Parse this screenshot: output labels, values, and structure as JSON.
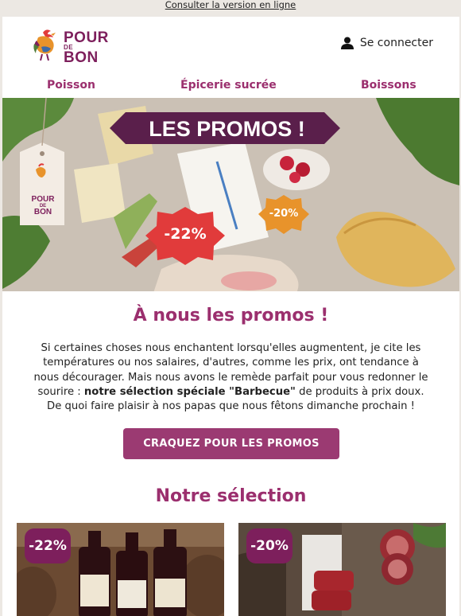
{
  "top_link": "Consulter la version en ligne",
  "brand": {
    "logo_line1": "POUR",
    "logo_de": "DE",
    "logo_line2": "BON"
  },
  "header": {
    "login_label": "Se connecter",
    "login_icon": "user-icon"
  },
  "nav": {
    "items": [
      {
        "label": "Poisson"
      },
      {
        "label": "Épicerie sucrée"
      },
      {
        "label": "Boissons"
      }
    ]
  },
  "hero": {
    "banner_text": "LES PROMOS !",
    "tag_line1": "POUR",
    "tag_de": "DE",
    "tag_line2": "BON",
    "badge_a": "-22%",
    "badge_b": "-20%"
  },
  "main": {
    "title": "À nous les promos !",
    "intro_part1": "Si certaines choses nous enchantent lorsqu'elles augmentent, je cite les températures ou nos salaires, d'autres, comme les prix, ont tendance à nous décourager. Mais nous avons le remède parfait pour vous redonner le sourire :",
    "intro_bold": "notre sélection spéciale \"Barbecue\"",
    "intro_part2": "de produits à prix doux. De quoi faire plaisir à nos papas que nous fêtons dimanche prochain !",
    "cta_label": "CRAQUEZ POUR LES PROMOS",
    "selection_title": "Notre sélection"
  },
  "products": [
    {
      "badge": "-22%"
    },
    {
      "badge": "-20%"
    }
  ],
  "colors": {
    "accent": "#9b2f6e",
    "brand_dark": "#7d1f5c",
    "cta": "#9b3a72",
    "badge_red": "#e13b3b",
    "badge_orange": "#e8932b"
  }
}
